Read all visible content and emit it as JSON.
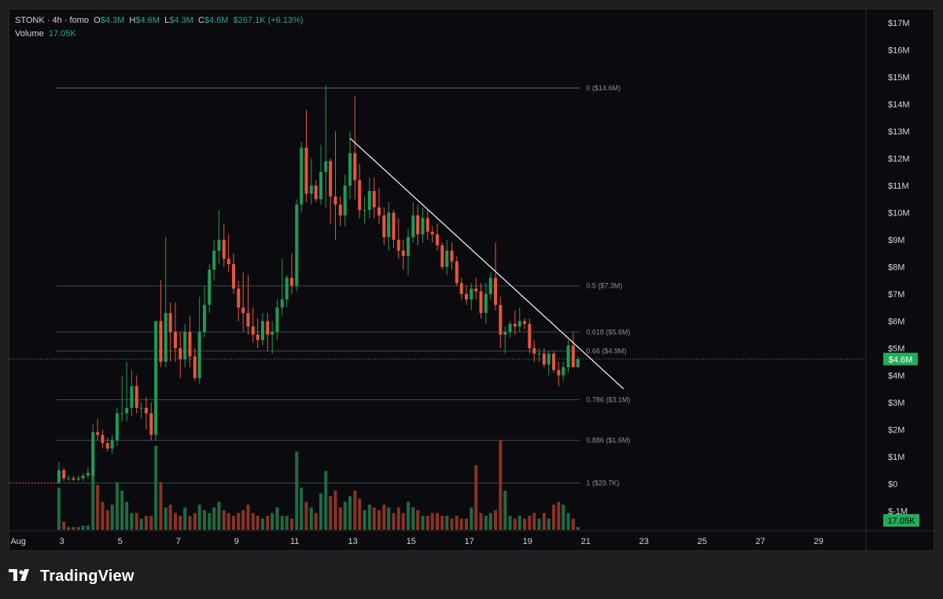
{
  "header": {
    "symbol": "STONK",
    "sep1": "·",
    "interval": "4h",
    "sep2": "·",
    "exchange": "fomo",
    "o_label": "O",
    "o_value": "$4.3M",
    "h_label": "H",
    "h_value": "$4.6M",
    "l_label": "L",
    "l_value": "$4.3M",
    "c_label": "C",
    "c_value": "$4.6M",
    "change": "$267.1K (+6.13%)",
    "volume_label": "Volume",
    "volume_value": "17.05K"
  },
  "colors": {
    "up": "#26a69a",
    "down": "#ef5350",
    "up_body": "#1f9a57",
    "down_body": "#e8553c",
    "trendline": "#ffffff",
    "fib_line": "#3a4a47",
    "price_badge": "#1fae5b"
  },
  "footer": {
    "brand": "TradingView",
    "logo_icon": "tradingview-logo-icon"
  },
  "chart_data": {
    "type": "candlestick",
    "y_axis": {
      "unit": "USD millions",
      "range": [
        -1.7,
        17.5
      ],
      "ticks": [
        17,
        16,
        15,
        14,
        13,
        12,
        11,
        10,
        9,
        8,
        7,
        6,
        5,
        4,
        3,
        2,
        1,
        0,
        -1
      ],
      "tick_labels": [
        "$17M",
        "$16M",
        "$15M",
        "$14M",
        "$13M",
        "$12M",
        "$11M",
        "$10M",
        "$9M",
        "$8M",
        "$7M",
        "$6M",
        "$5M",
        "$4M",
        "$3M",
        "$2M",
        "$1M",
        "$0",
        "$-1M"
      ]
    },
    "x_axis": {
      "unit": "day of August",
      "range": [
        1.2,
        30.6
      ],
      "ticks": [
        1.5,
        3,
        5,
        7,
        9,
        11,
        13,
        15,
        17,
        19,
        21,
        23,
        25,
        27,
        29
      ],
      "tick_labels": [
        "Aug",
        "3",
        "5",
        "7",
        "9",
        "11",
        "13",
        "15",
        "17",
        "19",
        "21",
        "23",
        "25",
        "27",
        "29"
      ]
    },
    "current_price": {
      "value": 4.6,
      "label": "$4.6M"
    },
    "current_volume": {
      "label": "17.05K"
    },
    "fib_levels": [
      {
        "value": 14.6,
        "label": "0 ($14.6M)"
      },
      {
        "value": 7.3,
        "label": "0.5 ($7.3M)"
      },
      {
        "value": 5.6,
        "label": "0.618 ($5.6M)"
      },
      {
        "value": 4.9,
        "label": "0.66 ($4.9M)"
      },
      {
        "value": 3.1,
        "label": "0.786 ($3.1M)"
      },
      {
        "value": 1.6,
        "label": "0.886 ($1.6M)"
      },
      {
        "value": 0.03,
        "label": "1 ($29.7K)"
      }
    ],
    "fib_x_range": [
      2.8,
      20.8
    ],
    "trendline": {
      "x1": 12.9,
      "y1": 12.75,
      "x2": 22.3,
      "y2": 3.5
    },
    "premarket_line": {
      "value": 0.03,
      "x1": 1.2,
      "x2": 2.9
    },
    "volume_max": 3.2,
    "candles": [
      {
        "x": 2.9,
        "o": 0.05,
        "h": 0.8,
        "l": 0.0,
        "c": 0.5,
        "v": 1.5
      },
      {
        "x": 3.07,
        "o": 0.5,
        "h": 0.6,
        "l": 0.1,
        "c": 0.2,
        "v": 0.3
      },
      {
        "x": 3.23,
        "o": 0.2,
        "h": 0.3,
        "l": 0.1,
        "c": 0.2,
        "v": 0.1
      },
      {
        "x": 3.4,
        "o": 0.2,
        "h": 0.3,
        "l": 0.1,
        "c": 0.15,
        "v": 0.1
      },
      {
        "x": 3.57,
        "o": 0.15,
        "h": 0.3,
        "l": 0.1,
        "c": 0.2,
        "v": 0.1
      },
      {
        "x": 3.73,
        "o": 0.2,
        "h": 0.4,
        "l": 0.1,
        "c": 0.3,
        "v": 0.15
      },
      {
        "x": 3.9,
        "o": 0.3,
        "h": 0.6,
        "l": 0.2,
        "c": 0.4,
        "v": 0.15
      },
      {
        "x": 4.07,
        "o": 0.3,
        "h": 2.2,
        "l": 0.2,
        "c": 1.9,
        "v": 2.4
      },
      {
        "x": 4.23,
        "o": 1.9,
        "h": 2.4,
        "l": 1.6,
        "c": 1.8,
        "v": 1.6
      },
      {
        "x": 4.4,
        "o": 1.8,
        "h": 2.0,
        "l": 1.3,
        "c": 1.5,
        "v": 1.0
      },
      {
        "x": 4.57,
        "o": 1.5,
        "h": 1.7,
        "l": 1.2,
        "c": 1.3,
        "v": 0.7
      },
      {
        "x": 4.73,
        "o": 1.3,
        "h": 1.8,
        "l": 1.1,
        "c": 1.6,
        "v": 0.9
      },
      {
        "x": 4.9,
        "o": 1.6,
        "h": 2.8,
        "l": 1.4,
        "c": 2.6,
        "v": 1.7
      },
      {
        "x": 5.07,
        "o": 2.6,
        "h": 4.0,
        "l": 2.3,
        "c": 2.6,
        "v": 1.4
      },
      {
        "x": 5.23,
        "o": 2.6,
        "h": 4.5,
        "l": 2.3,
        "c": 2.8,
        "v": 1.0
      },
      {
        "x": 5.4,
        "o": 2.8,
        "h": 4.2,
        "l": 2.5,
        "c": 3.6,
        "v": 0.6
      },
      {
        "x": 5.57,
        "o": 3.6,
        "h": 4.0,
        "l": 2.6,
        "c": 2.8,
        "v": 0.6
      },
      {
        "x": 5.73,
        "o": 2.8,
        "h": 3.0,
        "l": 2.4,
        "c": 2.8,
        "v": 0.4
      },
      {
        "x": 5.9,
        "o": 2.8,
        "h": 3.2,
        "l": 2.0,
        "c": 2.6,
        "v": 0.5
      },
      {
        "x": 6.07,
        "o": 2.6,
        "h": 3.0,
        "l": 1.6,
        "c": 1.8,
        "v": 0.5
      },
      {
        "x": 6.23,
        "o": 1.8,
        "h": 6.0,
        "l": 1.6,
        "c": 6.0,
        "v": 3.0
      },
      {
        "x": 6.4,
        "o": 6.0,
        "h": 7.5,
        "l": 4.3,
        "c": 4.5,
        "v": 1.7
      },
      {
        "x": 6.57,
        "o": 4.5,
        "h": 9.1,
        "l": 4.3,
        "c": 6.3,
        "v": 0.8
      },
      {
        "x": 6.73,
        "o": 6.3,
        "h": 6.7,
        "l": 4.5,
        "c": 5.6,
        "v": 0.9
      },
      {
        "x": 6.9,
        "o": 5.6,
        "h": 6.7,
        "l": 4.5,
        "c": 5.0,
        "v": 0.6
      },
      {
        "x": 7.07,
        "o": 5.0,
        "h": 5.6,
        "l": 3.9,
        "c": 4.6,
        "v": 0.5
      },
      {
        "x": 7.23,
        "o": 4.6,
        "h": 5.9,
        "l": 4.3,
        "c": 5.6,
        "v": 0.8
      },
      {
        "x": 7.4,
        "o": 5.6,
        "h": 6.2,
        "l": 4.3,
        "c": 4.7,
        "v": 0.5
      },
      {
        "x": 7.57,
        "o": 4.7,
        "h": 5.0,
        "l": 3.8,
        "c": 3.9,
        "v": 0.6
      },
      {
        "x": 7.73,
        "o": 3.9,
        "h": 6.9,
        "l": 3.7,
        "c": 5.6,
        "v": 0.9
      },
      {
        "x": 7.9,
        "o": 5.6,
        "h": 7.3,
        "l": 5.4,
        "c": 6.6,
        "v": 0.7
      },
      {
        "x": 8.07,
        "o": 6.6,
        "h": 8.1,
        "l": 6.3,
        "c": 7.9,
        "v": 0.6
      },
      {
        "x": 8.23,
        "o": 7.9,
        "h": 9.0,
        "l": 7.5,
        "c": 8.6,
        "v": 0.8
      },
      {
        "x": 8.4,
        "o": 8.6,
        "h": 10.1,
        "l": 8.1,
        "c": 9.0,
        "v": 1.0
      },
      {
        "x": 8.57,
        "o": 9.0,
        "h": 9.6,
        "l": 8.0,
        "c": 8.3,
        "v": 0.7
      },
      {
        "x": 8.73,
        "o": 8.3,
        "h": 9.2,
        "l": 7.8,
        "c": 8.1,
        "v": 0.6
      },
      {
        "x": 8.9,
        "o": 8.1,
        "h": 8.5,
        "l": 7.0,
        "c": 7.2,
        "v": 0.5
      },
      {
        "x": 9.07,
        "o": 7.2,
        "h": 7.5,
        "l": 6.0,
        "c": 6.5,
        "v": 0.6
      },
      {
        "x": 9.23,
        "o": 6.5,
        "h": 7.8,
        "l": 5.6,
        "c": 6.3,
        "v": 0.7
      },
      {
        "x": 9.4,
        "o": 6.3,
        "h": 7.7,
        "l": 5.5,
        "c": 5.8,
        "v": 0.9
      },
      {
        "x": 9.57,
        "o": 5.8,
        "h": 6.5,
        "l": 5.2,
        "c": 5.5,
        "v": 0.6
      },
      {
        "x": 9.73,
        "o": 5.5,
        "h": 6.1,
        "l": 5.0,
        "c": 5.3,
        "v": 0.5
      },
      {
        "x": 9.9,
        "o": 5.3,
        "h": 6.3,
        "l": 5.1,
        "c": 6.0,
        "v": 0.4
      },
      {
        "x": 10.07,
        "o": 6.0,
        "h": 6.3,
        "l": 4.9,
        "c": 5.5,
        "v": 0.5
      },
      {
        "x": 10.23,
        "o": 5.5,
        "h": 6.0,
        "l": 4.8,
        "c": 5.6,
        "v": 0.6
      },
      {
        "x": 10.4,
        "o": 5.6,
        "h": 6.8,
        "l": 5.3,
        "c": 6.5,
        "v": 0.8
      },
      {
        "x": 10.57,
        "o": 6.5,
        "h": 8.3,
        "l": 6.2,
        "c": 6.8,
        "v": 0.5
      },
      {
        "x": 10.73,
        "o": 6.8,
        "h": 7.7,
        "l": 6.5,
        "c": 7.6,
        "v": 0.5
      },
      {
        "x": 10.9,
        "o": 7.6,
        "h": 8.5,
        "l": 7.0,
        "c": 7.3,
        "v": 0.4
      },
      {
        "x": 11.07,
        "o": 7.3,
        "h": 10.5,
        "l": 7.1,
        "c": 10.3,
        "v": 2.8
      },
      {
        "x": 11.23,
        "o": 10.3,
        "h": 12.6,
        "l": 10.0,
        "c": 12.4,
        "v": 1.5
      },
      {
        "x": 11.4,
        "o": 12.4,
        "h": 13.8,
        "l": 10.4,
        "c": 10.7,
        "v": 1.0
      },
      {
        "x": 11.57,
        "o": 10.7,
        "h": 12.0,
        "l": 10.3,
        "c": 11.0,
        "v": 0.8
      },
      {
        "x": 11.73,
        "o": 11.0,
        "h": 11.2,
        "l": 10.4,
        "c": 10.5,
        "v": 0.6
      },
      {
        "x": 11.9,
        "o": 10.5,
        "h": 12.5,
        "l": 10.3,
        "c": 11.5,
        "v": 1.3
      },
      {
        "x": 12.07,
        "o": 11.5,
        "h": 14.7,
        "l": 10.2,
        "c": 11.9,
        "v": 2.1
      },
      {
        "x": 12.23,
        "o": 11.9,
        "h": 12.0,
        "l": 9.6,
        "c": 10.6,
        "v": 1.2
      },
      {
        "x": 12.4,
        "o": 10.6,
        "h": 13.0,
        "l": 9.0,
        "c": 10.3,
        "v": 1.4
      },
      {
        "x": 12.57,
        "o": 10.3,
        "h": 10.6,
        "l": 9.5,
        "c": 9.9,
        "v": 0.8
      },
      {
        "x": 12.73,
        "o": 9.9,
        "h": 11.4,
        "l": 9.5,
        "c": 11.0,
        "v": 1.0
      },
      {
        "x": 12.9,
        "o": 11.0,
        "h": 13.0,
        "l": 10.5,
        "c": 12.2,
        "v": 1.2
      },
      {
        "x": 13.07,
        "o": 12.2,
        "h": 14.3,
        "l": 10.5,
        "c": 11.2,
        "v": 1.4
      },
      {
        "x": 13.23,
        "o": 11.2,
        "h": 11.8,
        "l": 9.8,
        "c": 10.1,
        "v": 1.1
      },
      {
        "x": 13.4,
        "o": 10.1,
        "h": 10.6,
        "l": 9.6,
        "c": 10.1,
        "v": 0.7
      },
      {
        "x": 13.57,
        "o": 10.1,
        "h": 11.3,
        "l": 9.8,
        "c": 10.8,
        "v": 0.9
      },
      {
        "x": 13.73,
        "o": 10.8,
        "h": 11.3,
        "l": 9.8,
        "c": 10.2,
        "v": 0.8
      },
      {
        "x": 13.9,
        "o": 10.2,
        "h": 10.9,
        "l": 9.6,
        "c": 9.9,
        "v": 0.7
      },
      {
        "x": 14.07,
        "o": 9.9,
        "h": 10.2,
        "l": 8.8,
        "c": 9.1,
        "v": 0.9
      },
      {
        "x": 14.23,
        "o": 9.1,
        "h": 10.4,
        "l": 8.6,
        "c": 10.0,
        "v": 0.8
      },
      {
        "x": 14.4,
        "o": 10.0,
        "h": 10.1,
        "l": 8.7,
        "c": 9.0,
        "v": 0.6
      },
      {
        "x": 14.57,
        "o": 9.0,
        "h": 9.8,
        "l": 8.3,
        "c": 8.6,
        "v": 0.8
      },
      {
        "x": 14.73,
        "o": 8.6,
        "h": 9.0,
        "l": 7.9,
        "c": 8.4,
        "v": 0.6
      },
      {
        "x": 14.9,
        "o": 8.4,
        "h": 9.4,
        "l": 7.7,
        "c": 9.1,
        "v": 1.0
      },
      {
        "x": 15.07,
        "o": 9.1,
        "h": 10.4,
        "l": 8.9,
        "c": 9.9,
        "v": 0.8
      },
      {
        "x": 15.23,
        "o": 9.9,
        "h": 10.3,
        "l": 8.8,
        "c": 9.2,
        "v": 0.7
      },
      {
        "x": 15.4,
        "o": 9.2,
        "h": 10.2,
        "l": 8.9,
        "c": 9.8,
        "v": 0.5
      },
      {
        "x": 15.57,
        "o": 9.8,
        "h": 10.1,
        "l": 9.0,
        "c": 9.3,
        "v": 0.5
      },
      {
        "x": 15.73,
        "o": 9.3,
        "h": 9.5,
        "l": 8.9,
        "c": 9.2,
        "v": 0.6
      },
      {
        "x": 15.9,
        "o": 9.2,
        "h": 9.6,
        "l": 8.6,
        "c": 8.8,
        "v": 0.6
      },
      {
        "x": 16.07,
        "o": 8.8,
        "h": 8.9,
        "l": 7.9,
        "c": 8.0,
        "v": 0.5
      },
      {
        "x": 16.23,
        "o": 8.0,
        "h": 9.0,
        "l": 7.7,
        "c": 8.6,
        "v": 0.5
      },
      {
        "x": 16.4,
        "o": 8.6,
        "h": 8.9,
        "l": 7.9,
        "c": 8.2,
        "v": 0.4
      },
      {
        "x": 16.57,
        "o": 8.2,
        "h": 8.4,
        "l": 7.3,
        "c": 7.4,
        "v": 0.5
      },
      {
        "x": 16.73,
        "o": 7.4,
        "h": 7.6,
        "l": 6.8,
        "c": 7.0,
        "v": 0.4
      },
      {
        "x": 16.9,
        "o": 7.0,
        "h": 7.3,
        "l": 6.6,
        "c": 6.8,
        "v": 0.4
      },
      {
        "x": 17.07,
        "o": 6.8,
        "h": 7.4,
        "l": 6.4,
        "c": 7.2,
        "v": 0.8
      },
      {
        "x": 17.23,
        "o": 7.2,
        "h": 7.6,
        "l": 6.8,
        "c": 7.1,
        "v": 2.3
      },
      {
        "x": 17.4,
        "o": 7.1,
        "h": 7.4,
        "l": 6.1,
        "c": 6.3,
        "v": 0.6
      },
      {
        "x": 17.57,
        "o": 6.3,
        "h": 7.4,
        "l": 5.9,
        "c": 7.0,
        "v": 0.5
      },
      {
        "x": 17.73,
        "o": 7.0,
        "h": 7.8,
        "l": 6.8,
        "c": 7.6,
        "v": 0.6
      },
      {
        "x": 17.9,
        "o": 7.6,
        "h": 8.9,
        "l": 6.4,
        "c": 6.6,
        "v": 0.7
      },
      {
        "x": 18.07,
        "o": 6.6,
        "h": 6.9,
        "l": 5.0,
        "c": 5.5,
        "v": 3.2
      },
      {
        "x": 18.23,
        "o": 5.5,
        "h": 5.8,
        "l": 4.8,
        "c": 5.6,
        "v": 1.4
      },
      {
        "x": 18.4,
        "o": 5.6,
        "h": 6.0,
        "l": 5.4,
        "c": 5.9,
        "v": 0.5
      },
      {
        "x": 18.57,
        "o": 5.9,
        "h": 6.4,
        "l": 5.5,
        "c": 5.8,
        "v": 0.4
      },
      {
        "x": 18.73,
        "o": 5.8,
        "h": 6.5,
        "l": 5.6,
        "c": 6.0,
        "v": 0.5
      },
      {
        "x": 18.9,
        "o": 6.0,
        "h": 6.1,
        "l": 5.7,
        "c": 5.9,
        "v": 0.4
      },
      {
        "x": 19.07,
        "o": 5.9,
        "h": 6.1,
        "l": 4.8,
        "c": 5.0,
        "v": 0.5
      },
      {
        "x": 19.23,
        "o": 5.0,
        "h": 5.3,
        "l": 4.5,
        "c": 4.8,
        "v": 0.6
      },
      {
        "x": 19.4,
        "o": 4.8,
        "h": 5.0,
        "l": 4.5,
        "c": 4.8,
        "v": 0.4
      },
      {
        "x": 19.57,
        "o": 4.8,
        "h": 5.0,
        "l": 4.3,
        "c": 4.4,
        "v": 0.6
      },
      {
        "x": 19.73,
        "o": 4.4,
        "h": 4.9,
        "l": 4.0,
        "c": 4.8,
        "v": 0.4
      },
      {
        "x": 19.9,
        "o": 4.8,
        "h": 4.9,
        "l": 4.1,
        "c": 4.2,
        "v": 0.9
      },
      {
        "x": 20.07,
        "o": 4.2,
        "h": 4.5,
        "l": 3.6,
        "c": 4.0,
        "v": 1.0
      },
      {
        "x": 20.23,
        "o": 4.0,
        "h": 4.5,
        "l": 3.8,
        "c": 4.3,
        "v": 0.9
      },
      {
        "x": 20.4,
        "o": 4.3,
        "h": 5.3,
        "l": 4.1,
        "c": 5.1,
        "v": 0.6
      },
      {
        "x": 20.57,
        "o": 5.1,
        "h": 5.6,
        "l": 4.3,
        "c": 4.3,
        "v": 0.4
      },
      {
        "x": 20.73,
        "o": 4.3,
        "h": 4.7,
        "l": 4.3,
        "c": 4.6,
        "v": 0.1
      }
    ]
  }
}
